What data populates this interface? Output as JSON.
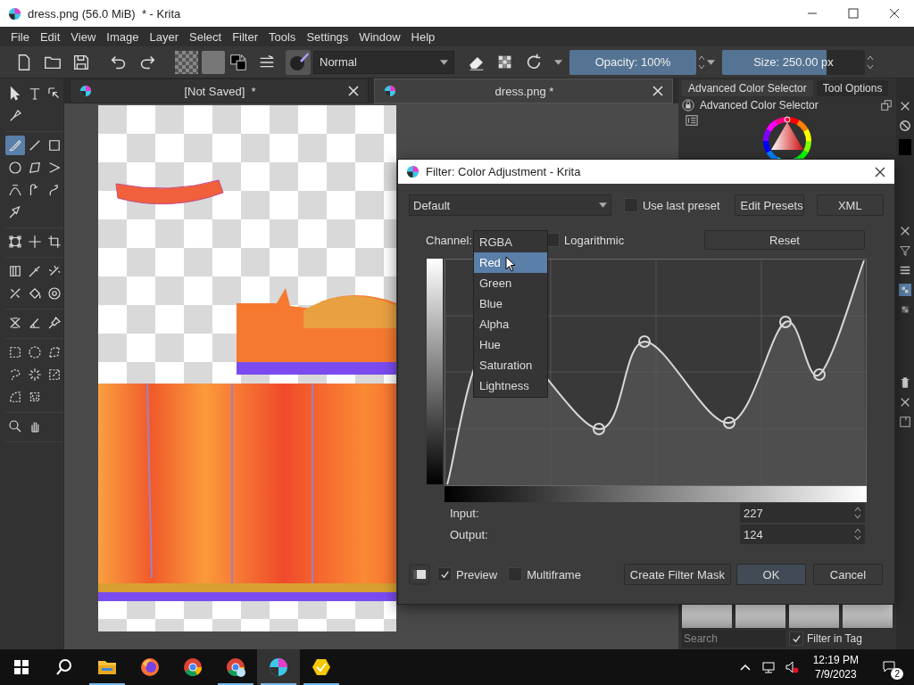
{
  "window": {
    "title": "dress.png (56.0 MiB)  * - Krita"
  },
  "menu": [
    "File",
    "Edit",
    "View",
    "Image",
    "Layer",
    "Select",
    "Filter",
    "Tools",
    "Settings",
    "Window",
    "Help"
  ],
  "toolbar": {
    "blend_mode": "Normal",
    "opacity": {
      "label": "Opacity: 100%",
      "level": 1
    },
    "size": {
      "label": "Size: 250.00 px",
      "level": 0.73
    }
  },
  "document_tabs": [
    {
      "title": "[Not Saved]  *",
      "selected": false
    },
    {
      "title": "dress.png *",
      "selected": true
    }
  ],
  "tool_groups": [
    [
      {
        "kind": "select-shape",
        "selected": false
      },
      {
        "kind": "text",
        "selected": false
      },
      {
        "kind": "edit-shape",
        "selected": false
      },
      {
        "kind": "calligraphy",
        "selected": false
      }
    ],
    [
      {
        "kind": "freehand-brush",
        "selected": true
      },
      {
        "kind": "line",
        "selected": false
      },
      {
        "kind": "rectangle",
        "selected": false
      },
      {
        "kind": "ellipse",
        "selected": false
      },
      {
        "kind": "polygon",
        "selected": false
      },
      {
        "kind": "polyline",
        "selected": false
      },
      {
        "kind": "bezier",
        "selected": false
      },
      {
        "kind": "freehand-path",
        "selected": false
      },
      {
        "kind": "dynamic-brush",
        "selected": false
      },
      {
        "kind": "multibrush",
        "selected": false
      }
    ],
    [
      {
        "kind": "transform",
        "selected": false
      },
      {
        "kind": "move",
        "selected": false
      },
      {
        "kind": "crop",
        "selected": false
      }
    ],
    [
      {
        "kind": "gradient",
        "selected": false
      },
      {
        "kind": "color-sampler",
        "selected": false
      },
      {
        "kind": "colorize",
        "selected": false
      },
      {
        "kind": "smart-patch",
        "selected": false
      },
      {
        "kind": "fill",
        "selected": false
      },
      {
        "kind": "enclose-fill",
        "selected": false
      }
    ],
    [
      {
        "kind": "assistant",
        "selected": false
      },
      {
        "kind": "measure",
        "selected": false
      },
      {
        "kind": "reference",
        "selected": false
      }
    ],
    [
      {
        "kind": "rect-select",
        "selected": false
      },
      {
        "kind": "ellipse-select",
        "selected": false
      },
      {
        "kind": "polygon-select",
        "selected": false
      },
      {
        "kind": "freehand-select",
        "selected": false
      },
      {
        "kind": "contiguous-select",
        "selected": false
      },
      {
        "kind": "similar-select",
        "selected": false
      },
      {
        "kind": "bezier-select",
        "selected": false
      },
      {
        "kind": "magnetic-select",
        "selected": false
      }
    ],
    [
      {
        "kind": "zoom",
        "selected": false
      },
      {
        "kind": "pan",
        "selected": false
      }
    ]
  ],
  "dockers": {
    "tabs": [
      {
        "label": "Advanced Color Selector",
        "selected": true
      },
      {
        "label": "Tool Options",
        "selected": false
      }
    ],
    "title": "Advanced Color Selector",
    "search": {
      "placeholder": "Search"
    },
    "filter_in_tag": {
      "label": "Filter in Tag",
      "checked": true
    }
  },
  "dialog": {
    "title": "Filter: Color Adjustment - Krita",
    "preset": "Default",
    "use_last_preset": {
      "label": "Use last preset",
      "checked": false
    },
    "top_buttons": [
      "Edit Presets",
      "XML"
    ],
    "channel_label": "Channel:",
    "channel_options": [
      {
        "label": "RGBA",
        "selected": false
      },
      {
        "label": "Red",
        "selected": true
      },
      {
        "label": "Green",
        "selected": false
      },
      {
        "label": "Blue",
        "selected": false
      },
      {
        "label": "Alpha",
        "selected": false
      },
      {
        "label": "Hue",
        "selected": false
      },
      {
        "label": "Saturation",
        "selected": false
      },
      {
        "label": "Lightness",
        "selected": false
      }
    ],
    "logarithmic": {
      "label": "Logarithmic",
      "checked": false
    },
    "reset": "Reset",
    "input": {
      "label": "Input:",
      "value": "227"
    },
    "output": {
      "label": "Output:",
      "value": "124"
    },
    "preview": {
      "label": "Preview",
      "checked": true
    },
    "multiframe": {
      "label": "Multiframe",
      "checked": false
    },
    "buttons": [
      "Create Filter Mask",
      "OK",
      "Cancel"
    ]
  },
  "taskbar": {
    "apps": [
      {
        "kind": "folder",
        "running": true,
        "selected": false
      },
      {
        "kind": "firefox",
        "running": false,
        "selected": false
      },
      {
        "kind": "chrome",
        "running": false,
        "selected": false
      },
      {
        "kind": "chrome-profile",
        "running": true,
        "selected": false
      },
      {
        "kind": "krita",
        "running": true,
        "selected": true
      },
      {
        "kind": "yellow-app",
        "running": true,
        "selected": false
      }
    ],
    "time": "12:19 PM",
    "date": "7/9/2023",
    "notifications": "2"
  }
}
